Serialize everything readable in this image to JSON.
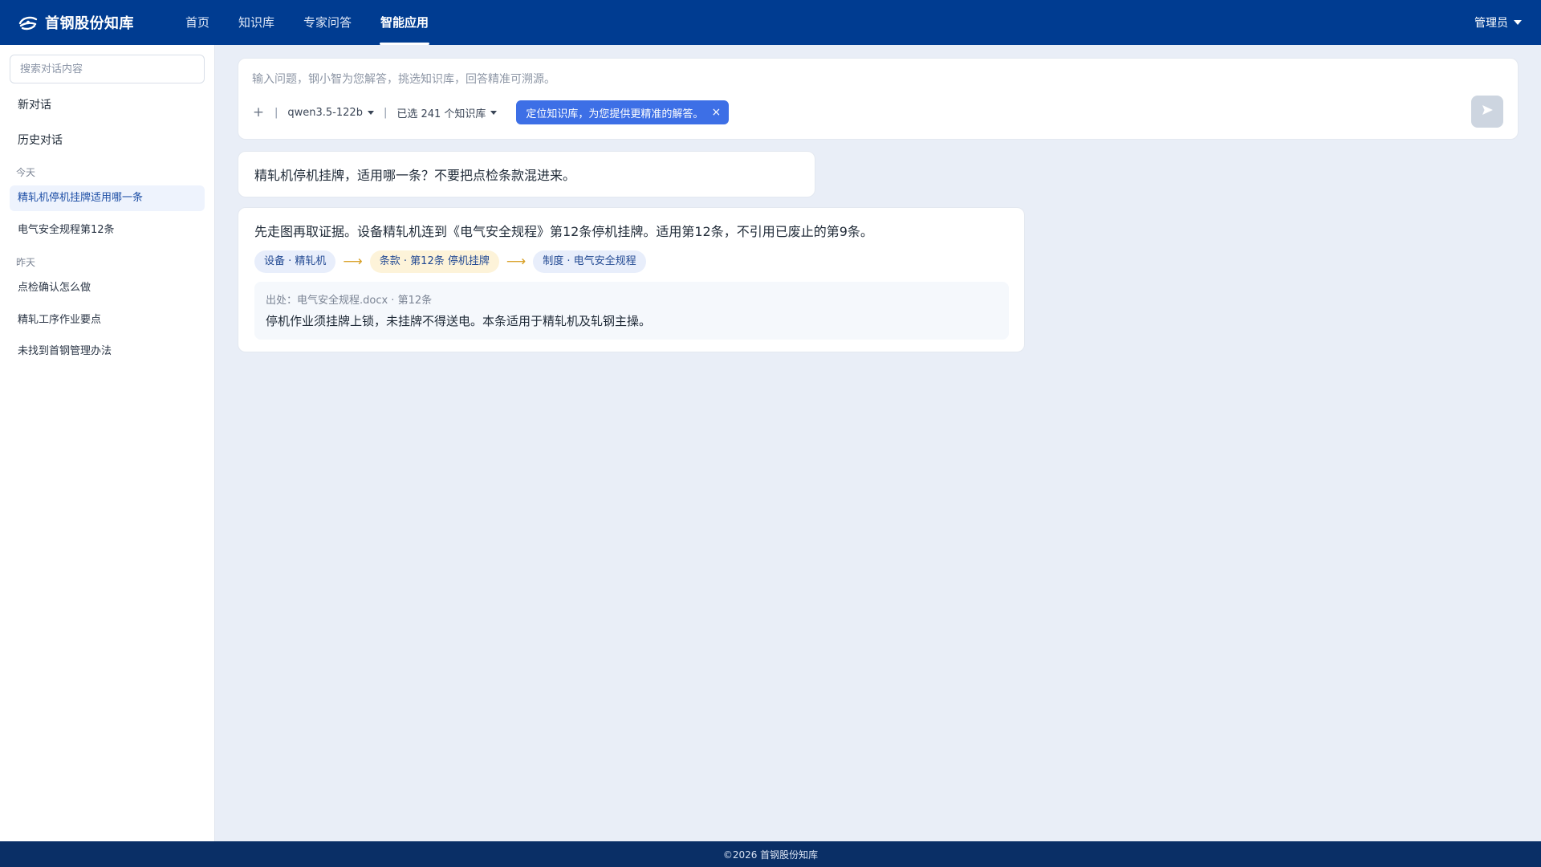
{
  "app": {
    "title": "首钢股份知库",
    "logo_icon": "steel-logo-icon",
    "accent_color": "#003c91"
  },
  "nav": {
    "items": [
      {
        "label": "首页",
        "active": false
      },
      {
        "label": "知识库",
        "active": false
      },
      {
        "label": "专家问答",
        "active": false
      },
      {
        "label": "智能应用",
        "active": true
      }
    ]
  },
  "user": {
    "label": "管理员"
  },
  "sidebar": {
    "search_placeholder": "搜索对话内容",
    "new_chat": "新对话",
    "history": "历史对话",
    "groups": [
      {
        "label": "今天",
        "items": [
          {
            "label": "精轧机停机挂牌适用哪一条",
            "active": true
          },
          {
            "label": "电气安全规程第12条",
            "active": false
          }
        ]
      },
      {
        "label": "昨天",
        "items": [
          {
            "label": "点检确认怎么做",
            "active": false
          },
          {
            "label": "精轧工序作业要点",
            "active": false
          },
          {
            "label": "未找到首钢管理办法",
            "active": false
          }
        ]
      }
    ]
  },
  "composer": {
    "placeholder": "输入问题，钢小智为您解答，挑选知识库，回答精准可溯源。",
    "plus_label": "+",
    "separator": "|",
    "model": "qwen3.5-122b",
    "kb_selected": "已选 241 个知识库",
    "tip": "定位知识库，为您提供更精准的解答。",
    "tip_close": "×",
    "send_icon": "send-icon"
  },
  "messages": {
    "user_question": "精轧机停机挂牌，适用哪一条？不要把点检条款混进来。",
    "answer_text": "先走图再取证据。设备精轧机连到《电气安全规程》第12条停机挂牌。适用第12条，不引用已废止的第9条。",
    "chain": [
      {
        "label": "设备 · 精轧机",
        "style": "blue"
      },
      {
        "label": "条款 · 第12条 停机挂牌",
        "style": "yellow"
      },
      {
        "label": "制度 · 电气安全规程",
        "style": "blue"
      }
    ],
    "chain_arrow": "⟶",
    "source_label": "出处：电气安全规程.docx · 第12条",
    "source_quote": "停机作业须挂牌上锁，未挂牌不得送电。本条适用于精轧机及轧钢主操。"
  },
  "footer": {
    "text": "©2026 首钢股份知库"
  }
}
